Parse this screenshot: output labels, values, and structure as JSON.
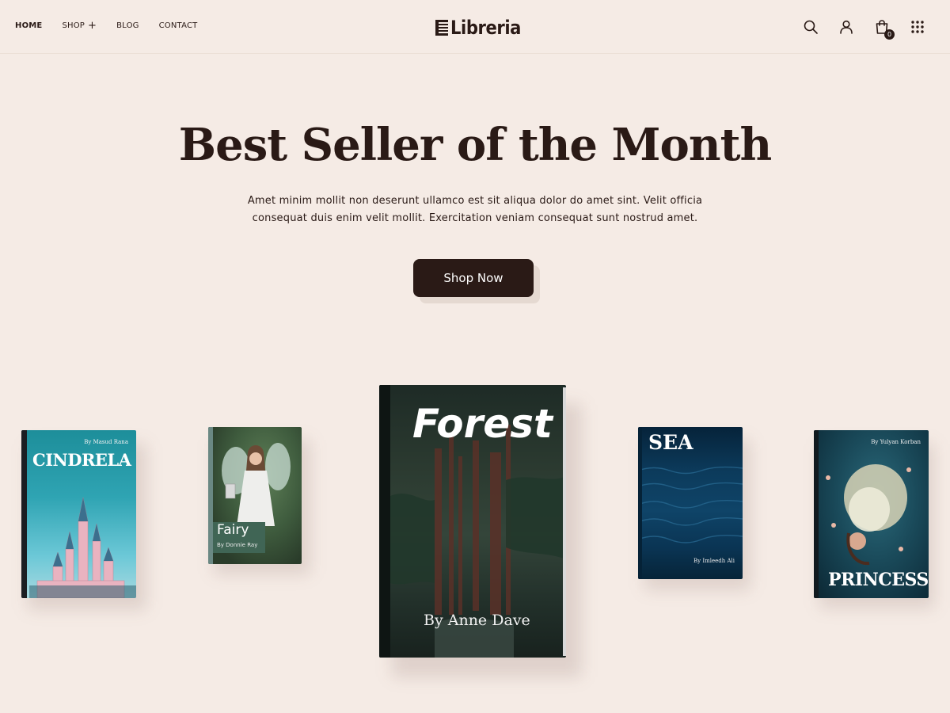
{
  "header": {
    "nav": [
      {
        "label": "HOME",
        "active": true
      },
      {
        "label": "SHOP",
        "dropdown_icon": "plus-icon"
      },
      {
        "label": "BLOG"
      },
      {
        "label": "CONTACT"
      }
    ],
    "logo_text": "Libreria",
    "icons": [
      "search-icon",
      "user-icon",
      "shopping-bag-icon",
      "grid-menu-icon"
    ],
    "cart_count": "0"
  },
  "hero": {
    "title": "Best Seller of the Month",
    "description": "Amet minim mollit non deserunt ullamco est sit aliqua dolor do amet sint. Velit officia consequat duis enim velit mollit. Exercitation veniam consequat sunt nostrud amet.",
    "cta_label": "Shop Now"
  },
  "books": [
    {
      "title": "CINDRELA",
      "author": "By Masud Rana"
    },
    {
      "title": "Fairy",
      "author": "By Donnie Ray"
    },
    {
      "title": "Forest",
      "author": "By Anne Dave"
    },
    {
      "title": "SEA",
      "author": "By Imleedh Ali"
    },
    {
      "title": "PRINCESS",
      "author": "By Yulyan Korban"
    }
  ],
  "colors": {
    "background": "#f5ebe5",
    "primary_dark": "#2a1a16",
    "button_shadow": "#e5d9d1"
  }
}
